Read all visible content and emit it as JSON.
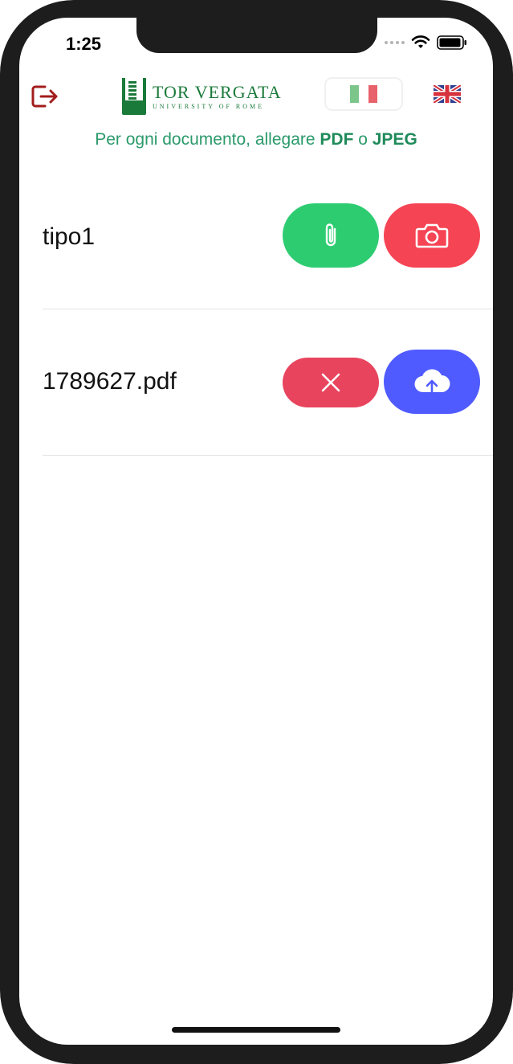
{
  "status_bar": {
    "time": "1:25"
  },
  "header": {
    "logo": {
      "title": "TOR VERGATA",
      "subtitle": "UNIVERSITY OF ROME"
    }
  },
  "hint": {
    "prefix": "Per ogni documento, allegare ",
    "pdf": "PDF",
    "connector": " o ",
    "jpeg": "JPEG"
  },
  "documents": [
    {
      "label": "tipo1",
      "actions": [
        "paperclip-icon",
        "camera-icon"
      ]
    },
    {
      "label": "1789627.pdf",
      "actions": [
        "close-icon",
        "cloud-upload-icon"
      ]
    }
  ],
  "colors": {
    "accent_green": "#2ecc71",
    "accent_red": "#f54454",
    "accent_blue": "#4f5bff",
    "logout_red": "#a31d1d",
    "hint_green": "#2b9a6b"
  }
}
